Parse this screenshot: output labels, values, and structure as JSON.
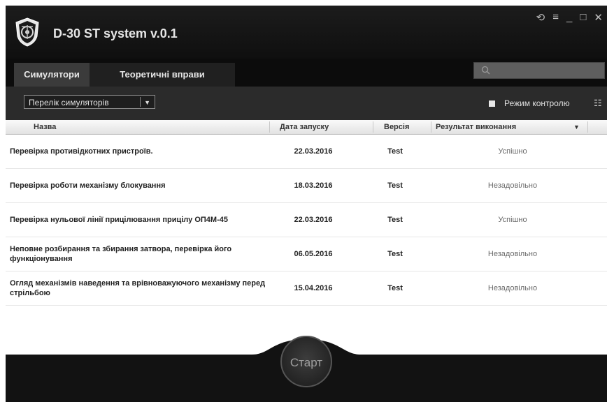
{
  "app": {
    "title": "D-30 ST system v.0.1"
  },
  "window_controls": [
    "⟲",
    "≡",
    "_",
    "□",
    "✕"
  ],
  "tabs": [
    {
      "label": "Симулятори",
      "active": true
    },
    {
      "label": "Теоретичні вправи",
      "active": false
    }
  ],
  "search": {
    "placeholder": "",
    "icon": "search-icon"
  },
  "toolbar": {
    "select_value": "Перелік симуляторів",
    "control_mode_label": "Режим контролю",
    "list_icon": "☷"
  },
  "table": {
    "columns": [
      "Назва",
      "Дата запуску",
      "Версія",
      "Результат виконання"
    ],
    "rows": [
      {
        "name": "Перевірка противідкотних пристроїв.",
        "date": "22.03.2016",
        "version": "Test",
        "result": "Успішно"
      },
      {
        "name": "Перевірка роботи механізму блокування",
        "date": "18.03.2016",
        "version": "Test",
        "result": "Незадовільно"
      },
      {
        "name": "Перевірка нульової лінії прицілювання прицілу ОП4М-45",
        "date": "22.03.2016",
        "version": "Test",
        "result": "Успішно"
      },
      {
        "name": "Неповне розбирання та збирання затвора, перевірка його функціонування",
        "date": "06.05.2016",
        "version": "Test",
        "result": "Незадовільно"
      },
      {
        "name": "Огляд механізмів наведення та врівноважуючого механізму перед стрільбою",
        "date": "15.04.2016",
        "version": "Test",
        "result": "Незадовільно"
      }
    ]
  },
  "start_button": {
    "label": "Старт"
  },
  "colors": {
    "window_bg": "#141414",
    "tab_active": "#3b3b3b",
    "toolbar": "#2b2b2b"
  }
}
